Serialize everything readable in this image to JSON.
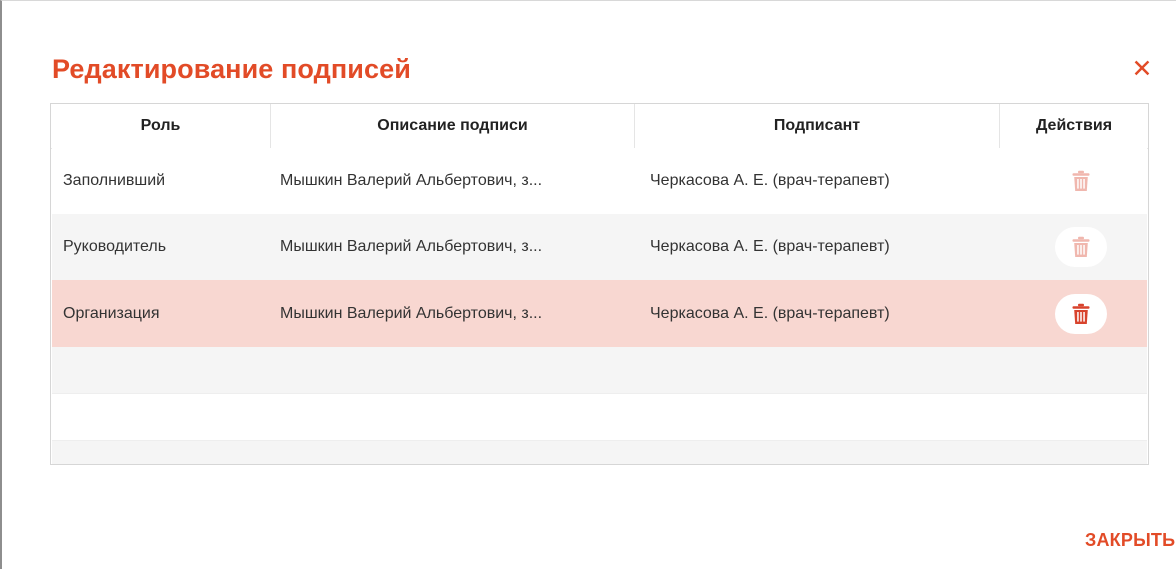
{
  "dialog": {
    "title": "Редактирование подписей",
    "close_icon": "close-icon",
    "close_label": "ЗАКРЫТЬ",
    "accent_color": "#e24b27"
  },
  "table": {
    "columns": [
      "Роль",
      "Описание подписи",
      "Подписант",
      "Действия"
    ],
    "rows": [
      {
        "role": "Заполнивший",
        "description": "Мышкин Валерий Альбертович, з...",
        "signer": "Черкасова А. Е. (врач-терапевт)",
        "action_icon": "trash-icon"
      },
      {
        "role": "Руководитель",
        "description": "Мышкин Валерий Альбертович, з...",
        "signer": "Черкасова А. Е. (врач-терапевт)",
        "action_icon": "trash-icon"
      },
      {
        "role": "Организация",
        "description": "Мышкин Валерий Альбертович, з...",
        "signer": "Черкасова А. Е. (врач-терапевт)",
        "action_icon": "trash-icon",
        "selected": true
      }
    ],
    "selected_row_color": "#f8d7d1",
    "alt_row_color": "#f5f5f5"
  }
}
